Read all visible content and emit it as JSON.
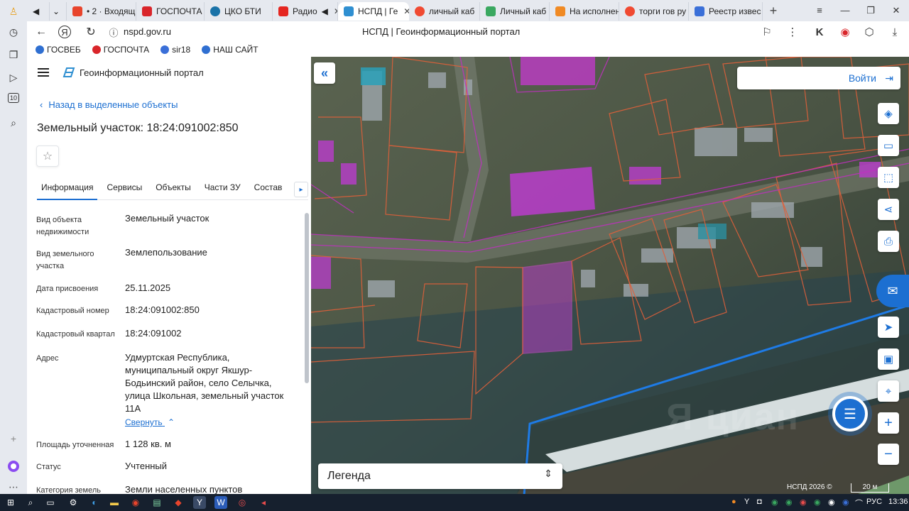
{
  "browser": {
    "tabs": [
      {
        "label": "• 2 · Входящ",
        "fav": "#e8442c",
        "active": false
      },
      {
        "label": "ГОСПОЧТА",
        "fav": "#d9252a",
        "active": false
      },
      {
        "label": "ЦКО БТИ",
        "fav": "#1a73a8",
        "active": false
      },
      {
        "label": "Радио",
        "fav": "#e52620",
        "active": false
      },
      {
        "label": "НСПД | Ге",
        "fav": "#2f8fd1",
        "active": true
      },
      {
        "label": "личный каб",
        "fav": "#f04a32",
        "active": false
      },
      {
        "label": "Личный каб",
        "fav": "#3aa860",
        "active": false
      },
      {
        "label": "На исполнен",
        "fav": "#f08a24",
        "active": false
      },
      {
        "label": "торги гов ру",
        "fav": "#f04a32",
        "active": false
      },
      {
        "label": "Реестр извес",
        "fav": "#3a6fd8",
        "active": false
      }
    ],
    "url": "nspd.gov.ru",
    "page_title": "НСПД | Геоинформационный портал",
    "bookmarks": [
      {
        "label": "ГОСВЕБ",
        "color": "#2f6fd1"
      },
      {
        "label": "ГОСПОЧТА",
        "color": "#d9252a"
      },
      {
        "label": "sir18",
        "color": "#3a6fd8"
      },
      {
        "label": "НАШ САЙТ",
        "color": "#2f6fd1"
      }
    ]
  },
  "panel": {
    "app_title": "Геоинформационный портал",
    "back_label": "Назад в выделенные объекты",
    "object_title": "Земельный участок: 18:24:091002:850",
    "tabs": [
      "Информация",
      "Сервисы",
      "Объекты",
      "Части ЗУ",
      "Состав"
    ],
    "active_tab": "Информация",
    "rows": [
      {
        "label": "Вид объекта недвижимости",
        "value": "Земельный участок"
      },
      {
        "label": "Вид земельного участка",
        "value": "Землепользование"
      },
      {
        "label": "Дата присвоения",
        "value": "25.11.2025"
      },
      {
        "label": "Кадастровый номер",
        "value": "18:24:091002:850"
      },
      {
        "label": "Кадастровый квартал",
        "value": "18:24:091002"
      },
      {
        "label": "Адрес",
        "value": "Удмуртская Республика, муниципальный округ Якшур-Бодьинский район, село Селычка, улица Школьная, земельный участок 11А"
      },
      {
        "label": "Площадь уточненная",
        "value": "1 128 кв. м"
      },
      {
        "label": "Статус",
        "value": "Учтенный"
      },
      {
        "label": "Категория земель",
        "value": "Земли населенных пунктов"
      }
    ],
    "collapse_label": "Свернуть"
  },
  "map": {
    "login_label": "Войти",
    "legend_label": "Легенда",
    "copyright": "НСПД 2026 ©",
    "scale_label": "20 м",
    "watermark": "Я циан"
  },
  "taskbar": {
    "lang": "РУС",
    "time": "13:36"
  },
  "colors": {
    "accent": "#1c6fd1",
    "parcel_selected": "#c846c8",
    "parcel_border": "#e0603a",
    "zone_border": "#1e7be6"
  }
}
